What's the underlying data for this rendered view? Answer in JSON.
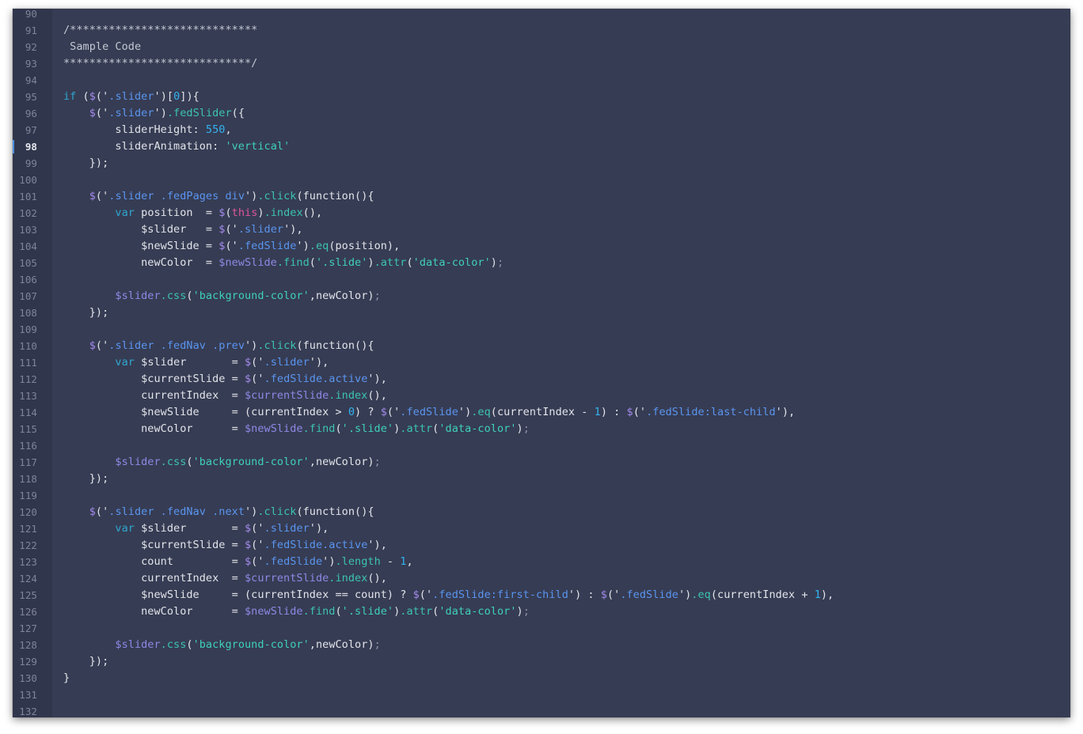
{
  "editor": {
    "active_line": 98,
    "colors": {
      "background": "#363c53",
      "gutter": "#30364b",
      "keyword": "#2fa6cf",
      "string": "#3fd0b9",
      "selector": "#5a95f0",
      "number": "#33b3f1",
      "function_call": "#a28aeb",
      "this": "#e0559a"
    },
    "lines": [
      {
        "n": 90,
        "t": [
          [
            "",
            "pl"
          ]
        ]
      },
      {
        "n": 91,
        "t": [
          [
            "/*****************************",
            "cm"
          ]
        ]
      },
      {
        "n": 92,
        "t": [
          [
            " Sample Code",
            "cm"
          ]
        ]
      },
      {
        "n": 93,
        "t": [
          [
            "*****************************/",
            "cm"
          ]
        ]
      },
      {
        "n": 94,
        "t": [
          [
            "",
            "pl"
          ]
        ]
      },
      {
        "n": 95,
        "t": [
          [
            "if ",
            "kw"
          ],
          [
            "(",
            "pl"
          ],
          [
            "$",
            "fn"
          ],
          [
            "('",
            "pl"
          ],
          [
            ".slider",
            "sel"
          ],
          [
            "')",
            "pl"
          ],
          [
            "[",
            "pl"
          ],
          [
            "0",
            "num"
          ],
          [
            "]){",
            "pl"
          ]
        ]
      },
      {
        "n": 96,
        "t": [
          [
            "    ",
            "pl"
          ],
          [
            "$",
            "fn"
          ],
          [
            "('",
            "pl"
          ],
          [
            ".slider",
            "sel"
          ],
          [
            "')",
            "pl"
          ],
          [
            ".fedSlider",
            "mth"
          ],
          [
            "({",
            "pl"
          ]
        ]
      },
      {
        "n": 97,
        "t": [
          [
            "        sliderHeight: ",
            "pl"
          ],
          [
            "550",
            "num"
          ],
          [
            ",",
            "pl"
          ]
        ]
      },
      {
        "n": 98,
        "t": [
          [
            "        sliderAnimation: ",
            "pl"
          ],
          [
            "'vertical'",
            "str"
          ]
        ]
      },
      {
        "n": 99,
        "t": [
          [
            "    });",
            "pl"
          ]
        ]
      },
      {
        "n": 100,
        "t": [
          [
            "",
            "pl"
          ]
        ]
      },
      {
        "n": 101,
        "t": [
          [
            "    ",
            "pl"
          ],
          [
            "$",
            "fn"
          ],
          [
            "('",
            "pl"
          ],
          [
            ".slider .fedPages div",
            "sel"
          ],
          [
            "')",
            "pl"
          ],
          [
            ".click",
            "mth"
          ],
          [
            "(function(){",
            "pl"
          ]
        ]
      },
      {
        "n": 102,
        "t": [
          [
            "        ",
            "pl"
          ],
          [
            "var ",
            "kw"
          ],
          [
            "position  = ",
            "pl"
          ],
          [
            "$",
            "fn"
          ],
          [
            "(",
            "pl"
          ],
          [
            "this",
            "ths"
          ],
          [
            ")",
            "pl"
          ],
          [
            ".index",
            "mth"
          ],
          [
            "(),",
            "pl"
          ]
        ]
      },
      {
        "n": 103,
        "t": [
          [
            "            $slider   = ",
            "pl"
          ],
          [
            "$",
            "fn"
          ],
          [
            "('",
            "pl"
          ],
          [
            ".slider",
            "sel"
          ],
          [
            "'),",
            "pl"
          ]
        ]
      },
      {
        "n": 104,
        "t": [
          [
            "            $newSlide = ",
            "pl"
          ],
          [
            "$",
            "fn"
          ],
          [
            "('",
            "pl"
          ],
          [
            ".fedSlide",
            "sel"
          ],
          [
            "')",
            "pl"
          ],
          [
            ".eq",
            "mth"
          ],
          [
            "(position),",
            "pl"
          ]
        ]
      },
      {
        "n": 105,
        "t": [
          [
            "            newColor  = ",
            "pl"
          ],
          [
            "$newSlide",
            "var"
          ],
          [
            ".find",
            "mth"
          ],
          [
            "(",
            "pl"
          ],
          [
            "'.slide'",
            "str"
          ],
          [
            ")",
            "pl"
          ],
          [
            ".attr",
            "mth"
          ],
          [
            "(",
            "pl"
          ],
          [
            "'data-color'",
            "str"
          ],
          [
            ")",
            "pl"
          ],
          [
            ";",
            "dim"
          ]
        ]
      },
      {
        "n": 106,
        "t": [
          [
            "",
            "pl"
          ]
        ]
      },
      {
        "n": 107,
        "t": [
          [
            "        ",
            "pl"
          ],
          [
            "$slider",
            "var"
          ],
          [
            ".css",
            "mth"
          ],
          [
            "(",
            "pl"
          ],
          [
            "'background-color'",
            "str"
          ],
          [
            ",newColor)",
            "pl"
          ],
          [
            ";",
            "dim"
          ]
        ]
      },
      {
        "n": 108,
        "t": [
          [
            "    });",
            "pl"
          ]
        ]
      },
      {
        "n": 109,
        "t": [
          [
            "",
            "pl"
          ]
        ]
      },
      {
        "n": 110,
        "t": [
          [
            "    ",
            "pl"
          ],
          [
            "$",
            "fn"
          ],
          [
            "('",
            "pl"
          ],
          [
            ".slider .fedNav .prev",
            "sel"
          ],
          [
            "')",
            "pl"
          ],
          [
            ".click",
            "mth"
          ],
          [
            "(function(){",
            "pl"
          ]
        ]
      },
      {
        "n": 111,
        "t": [
          [
            "        ",
            "pl"
          ],
          [
            "var ",
            "kw"
          ],
          [
            "$slider       = ",
            "pl"
          ],
          [
            "$",
            "fn"
          ],
          [
            "('",
            "pl"
          ],
          [
            ".slider",
            "sel"
          ],
          [
            "'),",
            "pl"
          ]
        ]
      },
      {
        "n": 112,
        "t": [
          [
            "            $currentSlide = ",
            "pl"
          ],
          [
            "$",
            "fn"
          ],
          [
            "('",
            "pl"
          ],
          [
            ".fedSlide.active",
            "sel"
          ],
          [
            "'),",
            "pl"
          ]
        ]
      },
      {
        "n": 113,
        "t": [
          [
            "            currentIndex  = ",
            "pl"
          ],
          [
            "$currentSlide",
            "var"
          ],
          [
            ".index",
            "mth"
          ],
          [
            "(),",
            "pl"
          ]
        ]
      },
      {
        "n": 114,
        "t": [
          [
            "            $newSlide     = (currentIndex > ",
            "pl"
          ],
          [
            "0",
            "num"
          ],
          [
            ") ? ",
            "pl"
          ],
          [
            "$",
            "fn"
          ],
          [
            "('",
            "pl"
          ],
          [
            ".fedSlide",
            "sel"
          ],
          [
            "')",
            "pl"
          ],
          [
            ".eq",
            "mth"
          ],
          [
            "(currentIndex - ",
            "pl"
          ],
          [
            "1",
            "num"
          ],
          [
            ") : ",
            "pl"
          ],
          [
            "$",
            "fn"
          ],
          [
            "('",
            "pl"
          ],
          [
            ".fedSlide:last-child",
            "sel"
          ],
          [
            "'),",
            "pl"
          ]
        ]
      },
      {
        "n": 115,
        "t": [
          [
            "            newColor      = ",
            "pl"
          ],
          [
            "$newSlide",
            "var"
          ],
          [
            ".find",
            "mth"
          ],
          [
            "(",
            "pl"
          ],
          [
            "'.slide'",
            "str"
          ],
          [
            ")",
            "pl"
          ],
          [
            ".attr",
            "mth"
          ],
          [
            "(",
            "pl"
          ],
          [
            "'data-color'",
            "str"
          ],
          [
            ")",
            "pl"
          ],
          [
            ";",
            "dim"
          ]
        ]
      },
      {
        "n": 116,
        "t": [
          [
            "",
            "pl"
          ]
        ]
      },
      {
        "n": 117,
        "t": [
          [
            "        ",
            "pl"
          ],
          [
            "$slider",
            "var"
          ],
          [
            ".css",
            "mth"
          ],
          [
            "(",
            "pl"
          ],
          [
            "'background-color'",
            "str"
          ],
          [
            ",newColor)",
            "pl"
          ],
          [
            ";",
            "dim"
          ]
        ]
      },
      {
        "n": 118,
        "t": [
          [
            "    });",
            "pl"
          ]
        ]
      },
      {
        "n": 119,
        "t": [
          [
            "",
            "pl"
          ]
        ]
      },
      {
        "n": 120,
        "t": [
          [
            "    ",
            "pl"
          ],
          [
            "$",
            "fn"
          ],
          [
            "('",
            "pl"
          ],
          [
            ".slider .fedNav .next",
            "sel"
          ],
          [
            "')",
            "pl"
          ],
          [
            ".click",
            "mth"
          ],
          [
            "(function(){",
            "pl"
          ]
        ]
      },
      {
        "n": 121,
        "t": [
          [
            "        ",
            "pl"
          ],
          [
            "var ",
            "kw"
          ],
          [
            "$slider       = ",
            "pl"
          ],
          [
            "$",
            "fn"
          ],
          [
            "('",
            "pl"
          ],
          [
            ".slider",
            "sel"
          ],
          [
            "'),",
            "pl"
          ]
        ]
      },
      {
        "n": 122,
        "t": [
          [
            "            $currentSlide = ",
            "pl"
          ],
          [
            "$",
            "fn"
          ],
          [
            "('",
            "pl"
          ],
          [
            ".fedSlide.active",
            "sel"
          ],
          [
            "'),",
            "pl"
          ]
        ]
      },
      {
        "n": 123,
        "t": [
          [
            "            count         = ",
            "pl"
          ],
          [
            "$",
            "fn"
          ],
          [
            "('",
            "pl"
          ],
          [
            ".fedSlide",
            "sel"
          ],
          [
            "')",
            "pl"
          ],
          [
            ".length",
            "mth"
          ],
          [
            " - ",
            "pl"
          ],
          [
            "1",
            "num"
          ],
          [
            ",",
            "pl"
          ]
        ]
      },
      {
        "n": 124,
        "t": [
          [
            "            currentIndex  = ",
            "pl"
          ],
          [
            "$currentSlide",
            "var"
          ],
          [
            ".index",
            "mth"
          ],
          [
            "(),",
            "pl"
          ]
        ]
      },
      {
        "n": 125,
        "t": [
          [
            "            $newSlide     = (currentIndex == count) ? ",
            "pl"
          ],
          [
            "$",
            "fn"
          ],
          [
            "('",
            "pl"
          ],
          [
            ".fedSlide:first-child",
            "sel"
          ],
          [
            "') : ",
            "pl"
          ],
          [
            "$",
            "fn"
          ],
          [
            "('",
            "pl"
          ],
          [
            ".fedSlide",
            "sel"
          ],
          [
            "')",
            "pl"
          ],
          [
            ".eq",
            "mth"
          ],
          [
            "(currentIndex + ",
            "pl"
          ],
          [
            "1",
            "num"
          ],
          [
            "),",
            "pl"
          ]
        ]
      },
      {
        "n": 126,
        "t": [
          [
            "            newColor      = ",
            "pl"
          ],
          [
            "$newSlide",
            "var"
          ],
          [
            ".find",
            "mth"
          ],
          [
            "(",
            "pl"
          ],
          [
            "'.slide'",
            "str"
          ],
          [
            ")",
            "pl"
          ],
          [
            ".attr",
            "mth"
          ],
          [
            "(",
            "pl"
          ],
          [
            "'data-color'",
            "str"
          ],
          [
            ")",
            "pl"
          ],
          [
            ";",
            "dim"
          ]
        ]
      },
      {
        "n": 127,
        "t": [
          [
            "",
            "pl"
          ]
        ]
      },
      {
        "n": 128,
        "t": [
          [
            "        ",
            "pl"
          ],
          [
            "$slider",
            "var"
          ],
          [
            ".css",
            "mth"
          ],
          [
            "(",
            "pl"
          ],
          [
            "'background-color'",
            "str"
          ],
          [
            ",newColor)",
            "pl"
          ],
          [
            ";",
            "dim"
          ]
        ]
      },
      {
        "n": 129,
        "t": [
          [
            "    });",
            "pl"
          ]
        ]
      },
      {
        "n": 130,
        "t": [
          [
            "}",
            "pl"
          ]
        ]
      },
      {
        "n": 131,
        "t": [
          [
            "",
            "pl"
          ]
        ]
      },
      {
        "n": 132,
        "t": [
          [
            "",
            "pl"
          ]
        ]
      }
    ]
  }
}
